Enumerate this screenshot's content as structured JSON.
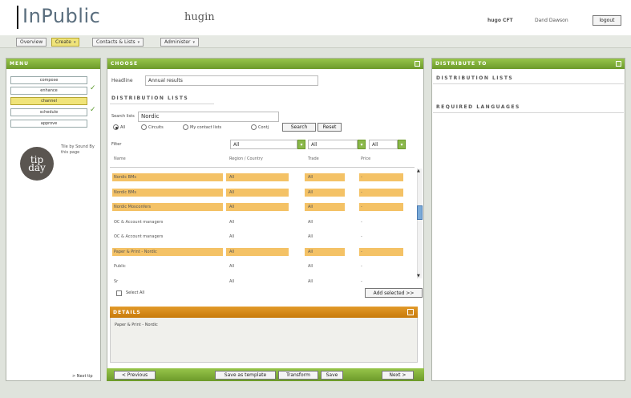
{
  "header": {
    "logo": "InPublic",
    "product": "hugin",
    "company": "hugo CFT",
    "user": "Dand Dawson",
    "logout": "logout"
  },
  "nav": {
    "tabs": [
      {
        "label": "Overview",
        "active": false
      },
      {
        "label": "Create",
        "active": true
      },
      {
        "label": "Contacts & Lists",
        "active": false
      },
      {
        "label": "Administer",
        "active": false
      }
    ]
  },
  "menu": {
    "title": "MENU",
    "items": [
      {
        "label": "compose",
        "active": false,
        "check": false
      },
      {
        "label": "enhance",
        "active": false,
        "check": true
      },
      {
        "label": "channel",
        "active": true,
        "check": false
      },
      {
        "label": "schedule",
        "active": false,
        "check": true
      },
      {
        "label": "approve",
        "active": false,
        "check": false
      }
    ],
    "tip": {
      "line1": "tip",
      "line2": "day",
      "text": "Tile by Sound By this page"
    },
    "next_tip": "> Next tip"
  },
  "choose": {
    "title": "CHOOSE",
    "headline_label": "Headline",
    "headline_value": "Annual results",
    "dl_title": "DISTRIBUTION LISTS",
    "search_label": "Search lists",
    "search_value": "Nordic",
    "radios": [
      {
        "label": "All",
        "on": true
      },
      {
        "label": "Circuits",
        "on": false
      },
      {
        "label": "My contact lists",
        "on": false
      },
      {
        "label": "Contj",
        "on": false
      }
    ],
    "search_btn": "Search",
    "reset_btn": "Reset",
    "filter_label": "Filter",
    "filters": [
      "All",
      "All",
      "All"
    ],
    "columns": [
      "Name",
      "Region / Country",
      "Trade",
      "Price"
    ],
    "rows": [
      {
        "name": "Nordic BMs",
        "region": "All",
        "trade": "All",
        "price": "-",
        "hl": true
      },
      {
        "name": "Nordic BMs",
        "region": "All",
        "trade": "All",
        "price": "-",
        "hl": true
      },
      {
        "name": "Nordic Mosconfers",
        "region": "All",
        "trade": "All",
        "price": "-",
        "hl": true
      },
      {
        "name": "OC & Account managers",
        "region": "All",
        "trade": "All",
        "price": "-",
        "hl": false
      },
      {
        "name": "OC & Account managers",
        "region": "All",
        "trade": "All",
        "price": "-",
        "hl": false
      },
      {
        "name": "Paper & Print - Nordic",
        "region": "All",
        "trade": "All",
        "price": "-",
        "hl": true
      },
      {
        "name": "Public",
        "region": "All",
        "trade": "All",
        "price": "-",
        "hl": false
      },
      {
        "name": "Sr",
        "region": "All",
        "trade": "All",
        "price": "-",
        "hl": false
      }
    ],
    "select_all": "Select All",
    "add_selected": "Add selected >>",
    "details_title": "DETAILS",
    "details_text": "Paper & Print - Nordic",
    "footer": {
      "previous": "< Previous",
      "save_template": "Save as template",
      "transform": "Transform",
      "save": "Save",
      "next": "Next >"
    }
  },
  "distribute": {
    "title": "DISTRIBUTE TO",
    "dl_label": "DISTRIBUTION LISTS",
    "lang_label": "REQUIRED LANGUAGES"
  },
  "colors": {
    "green": "#7aaa36",
    "orange": "#d08a1a",
    "highlight": "#f4c266",
    "active_tab": "#f0e47a"
  }
}
